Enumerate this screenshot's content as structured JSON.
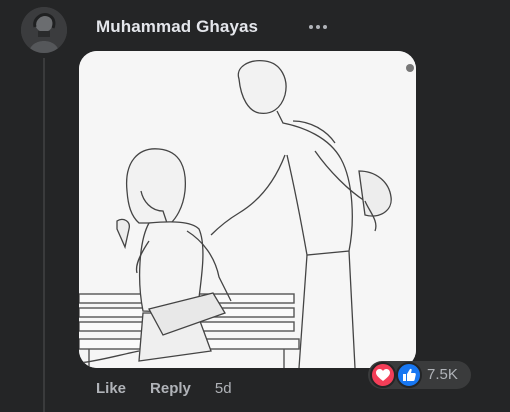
{
  "comment": {
    "author": "Muhammad Ghayas",
    "actions": {
      "like": "Like",
      "reply": "Reply",
      "time": "5d"
    },
    "reactions": {
      "count": "7.5K",
      "icons": [
        "love-icon",
        "like-icon"
      ]
    }
  },
  "colors": {
    "background": "#242526",
    "text_primary": "#e4e6eb",
    "text_secondary": "#b0b3b8",
    "love": "#f33e58",
    "like": "#1877f2"
  }
}
